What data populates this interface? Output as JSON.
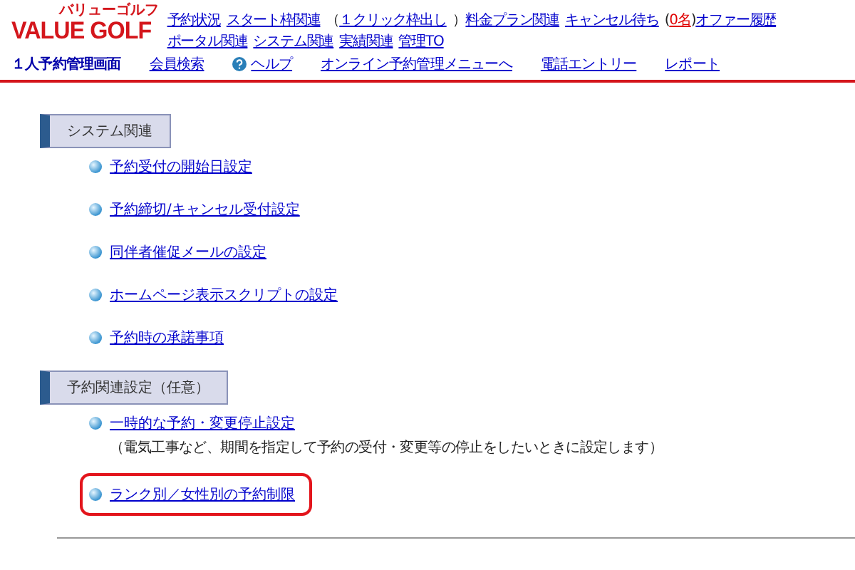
{
  "logo": {
    "text": "VALUE GOLF",
    "sub": "バリューゴルフ"
  },
  "nav": [
    {
      "text": "予約状況",
      "kind": "link"
    },
    {
      "text": "スタート枠関連",
      "kind": "link"
    },
    {
      "text": "（",
      "kind": "paren"
    },
    {
      "text": "１クリック枠出し",
      "kind": "link"
    },
    {
      "text": "）",
      "kind": "paren"
    },
    {
      "text": "料金プラン関連",
      "kind": "link"
    },
    {
      "text": "キャンセル待ち",
      "kind": "link"
    },
    {
      "text": "(",
      "kind": "paren"
    },
    {
      "text": "0名",
      "kind": "alert"
    },
    {
      "text": ")",
      "kind": "paren"
    },
    {
      "text": "オファー履歴",
      "kind": "link"
    },
    {
      "text": "ポータル関連",
      "kind": "link"
    },
    {
      "text": "システム関連",
      "kind": "link"
    },
    {
      "text": "実績関連",
      "kind": "link"
    },
    {
      "text": "管理TO",
      "kind": "link"
    }
  ],
  "subnav": [
    {
      "text": "１人予約管理画面",
      "kind": "title"
    },
    {
      "text": "会員検索",
      "kind": "link"
    },
    {
      "text": "ヘルプ",
      "kind": "help"
    },
    {
      "text": "オンライン予約管理メニューへ",
      "kind": "link"
    },
    {
      "text": "電話エントリー",
      "kind": "link"
    },
    {
      "text": "レポート",
      "kind": "link"
    }
  ],
  "sections": [
    {
      "title": "システム関連",
      "items": [
        {
          "text": "予約受付の開始日設定",
          "highlighted": false
        },
        {
          "text": "予約締切/キャンセル受付設定",
          "highlighted": false
        },
        {
          "text": "同伴者催促メールの設定",
          "highlighted": false
        },
        {
          "text": "ホームページ表示スクリプトの設定",
          "highlighted": false
        },
        {
          "text": "予約時の承諾事項",
          "highlighted": false
        }
      ]
    },
    {
      "title": "予約関連設定（任意）",
      "items": [
        {
          "text": "一時的な予約・変更停止設定",
          "note": "（電気工事など、期間を指定して予約の受付・変更等の停止をしたいときに設定します）",
          "highlighted": false
        },
        {
          "text": "ランク別／女性別の予約制限",
          "highlighted": true
        }
      ]
    }
  ]
}
